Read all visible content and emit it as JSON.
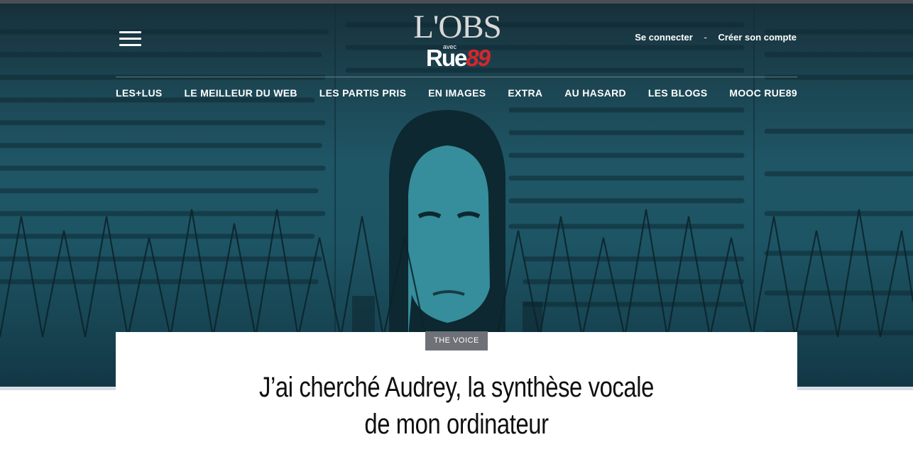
{
  "header": {
    "logo": {
      "brand": "L'OBS",
      "avec": "avec",
      "rue": "Rue",
      "num": "89"
    },
    "account": {
      "login": "Se connecter",
      "separator": "-",
      "signup": "Créer son compte"
    },
    "menu_icon": "hamburger-menu-icon"
  },
  "nav": {
    "items": [
      {
        "label": "LES+LUS"
      },
      {
        "label": "LE MEILLEUR DU WEB"
      },
      {
        "label": "LES PARTIS PRIS"
      },
      {
        "label": "EN IMAGES"
      },
      {
        "label": "EXTRA"
      },
      {
        "label": "AU HASARD"
      },
      {
        "label": "LES BLOGS"
      },
      {
        "label": "MOOC RUE89"
      }
    ]
  },
  "article": {
    "category": "THE VOICE",
    "title_line1": "J’ai cherché Audrey, la synthèse vocale",
    "title_line2": "de mon ordinateur"
  },
  "colors": {
    "hero_teal": "#1f5666",
    "rue89_red": "#d7262c",
    "tag_gray": "#6e7178"
  }
}
